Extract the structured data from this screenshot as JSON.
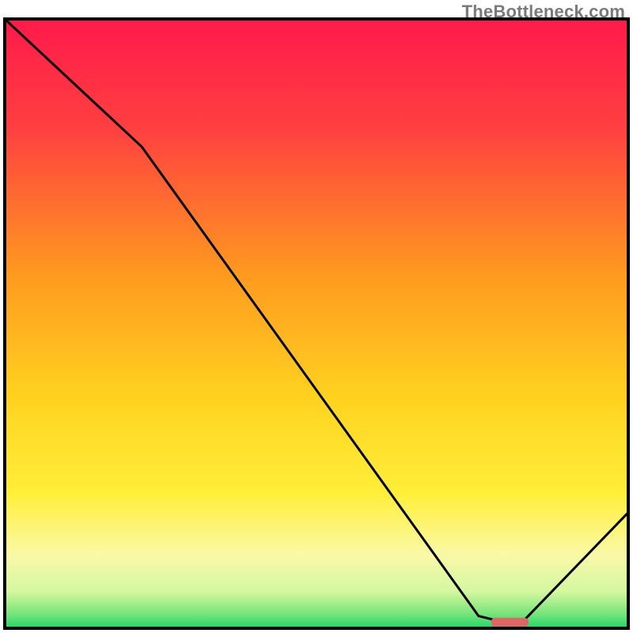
{
  "watermark": "TheBottleneck.com",
  "chart_data": {
    "type": "line",
    "title": "",
    "xlabel": "",
    "ylabel": "",
    "xlim": [
      0,
      100
    ],
    "ylim": [
      0,
      100
    ],
    "series": [
      {
        "name": "curve",
        "x": [
          0,
          22,
          76,
          80,
          83,
          100
        ],
        "y": [
          100,
          79,
          2,
          1,
          1,
          19
        ]
      }
    ],
    "marker": {
      "name": "highlight-segment",
      "x_start": 78,
      "x_end": 84,
      "y": 1,
      "color": "#e06666"
    },
    "background_gradient": {
      "stops": [
        {
          "offset": 0.0,
          "color": "#ff1a4b"
        },
        {
          "offset": 0.18,
          "color": "#ff4040"
        },
        {
          "offset": 0.42,
          "color": "#ff9a1f"
        },
        {
          "offset": 0.62,
          "color": "#ffd21f"
        },
        {
          "offset": 0.78,
          "color": "#ffef3a"
        },
        {
          "offset": 0.88,
          "color": "#faf9a8"
        },
        {
          "offset": 0.94,
          "color": "#d3f7a0"
        },
        {
          "offset": 0.975,
          "color": "#7be57b"
        },
        {
          "offset": 1.0,
          "color": "#1fd66b"
        }
      ]
    },
    "frame": {
      "stroke": "#000000",
      "stroke_width": 4
    },
    "curve_style": {
      "stroke": "#000000",
      "stroke_width": 3
    }
  }
}
